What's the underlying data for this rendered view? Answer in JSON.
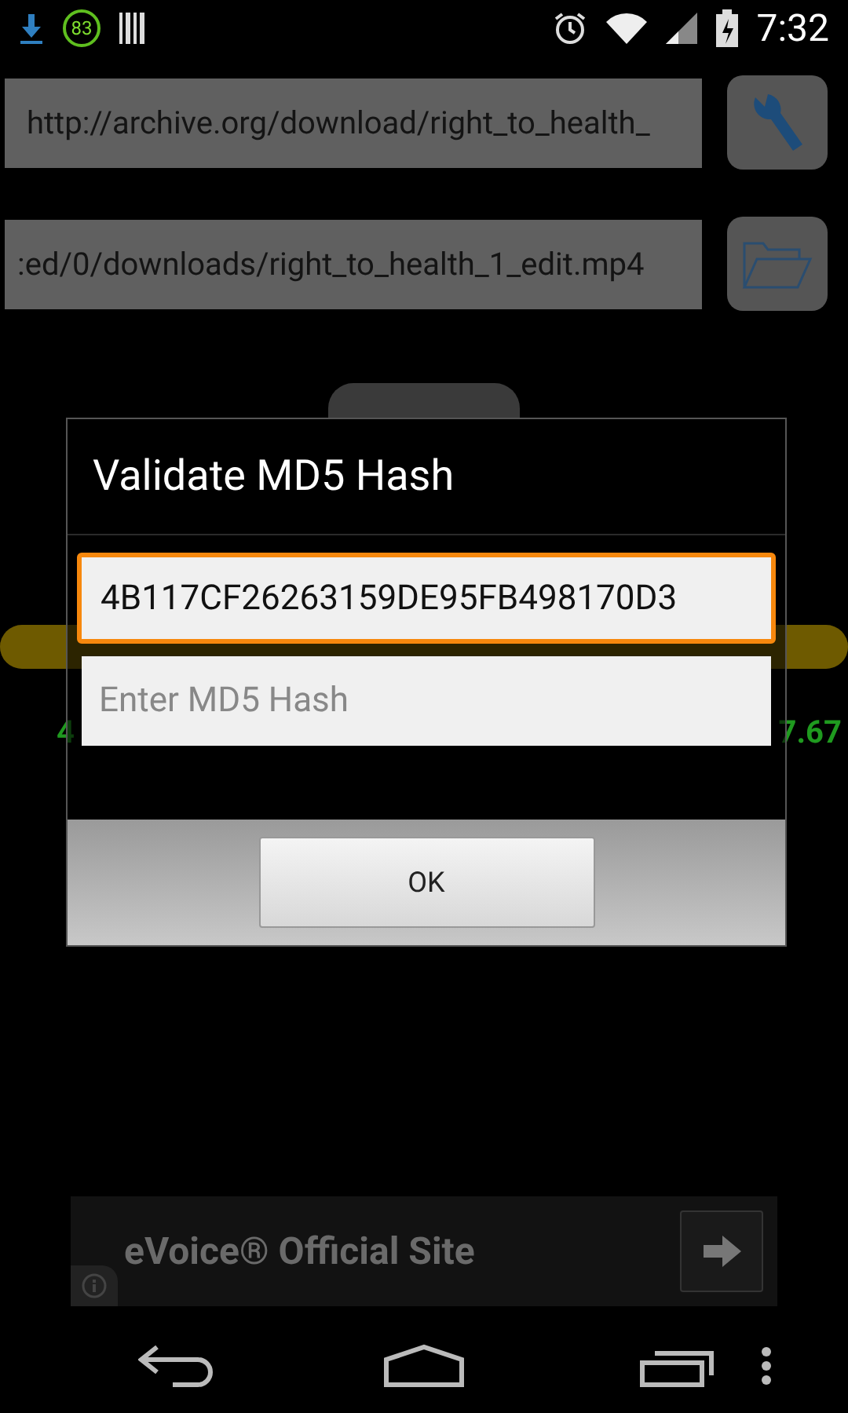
{
  "status_bar": {
    "badge": "83",
    "time": "7:32"
  },
  "url_field": {
    "value": "http://archive.org/download/right_to_health_"
  },
  "path_field": {
    "value": ":ed/0/downloads/right_to_health_1_edit.mp4"
  },
  "progress_bar": {
    "level": 1
  },
  "background_stats": {
    "left_value": "4",
    "right_value": "7.67"
  },
  "dialog": {
    "title": "Validate MD5 Hash",
    "hash_field": {
      "value": "4B117CF26263159DE95FB498170D3",
      "focused": true
    },
    "input_field": {
      "placeholder": "Enter MD5 Hash"
    },
    "buttons": [
      "OK"
    ]
  },
  "ad": {
    "text": "eVoice® Official Site"
  }
}
